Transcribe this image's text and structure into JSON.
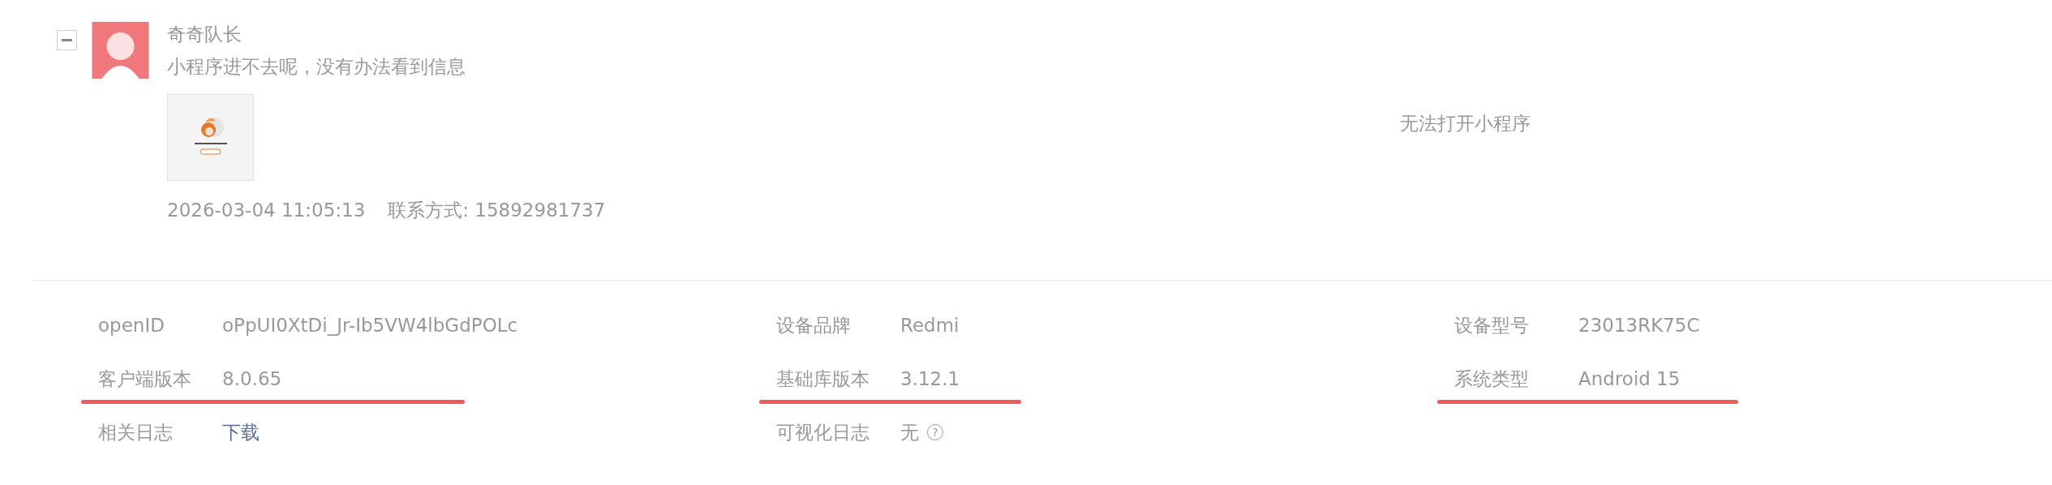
{
  "feedback": {
    "expanded": true,
    "user_name": "奇奇队长",
    "message": "小程序进不去呢，没有办法看到信息",
    "time": "2026-03-04 11:05:13",
    "contact": "联系方式: 15892981737",
    "category": "无法打开小程序"
  },
  "details": [
    {
      "label": "openID",
      "value": "oPpUI0XtDi_Jr-Ib5VW4lbGdPOLc",
      "kind": "text",
      "underlined": false
    },
    {
      "label": "设备品牌",
      "value": "Redmi",
      "kind": "text",
      "underlined": false
    },
    {
      "label": "设备型号",
      "value": "23013RK75C",
      "kind": "text",
      "underlined": false
    },
    {
      "label": "客户端版本",
      "value": "8.0.65",
      "kind": "text",
      "underlined": true
    },
    {
      "label": "基础库版本",
      "value": "3.12.1",
      "kind": "text",
      "underlined": true
    },
    {
      "label": "系统类型",
      "value": "Android 15",
      "kind": "text",
      "underlined": true
    },
    {
      "label": "相关日志",
      "value": "下载",
      "kind": "link",
      "underlined": false
    },
    {
      "label": "可视化日志",
      "value": "无",
      "kind": "help",
      "help": "?",
      "underlined": false
    }
  ]
}
